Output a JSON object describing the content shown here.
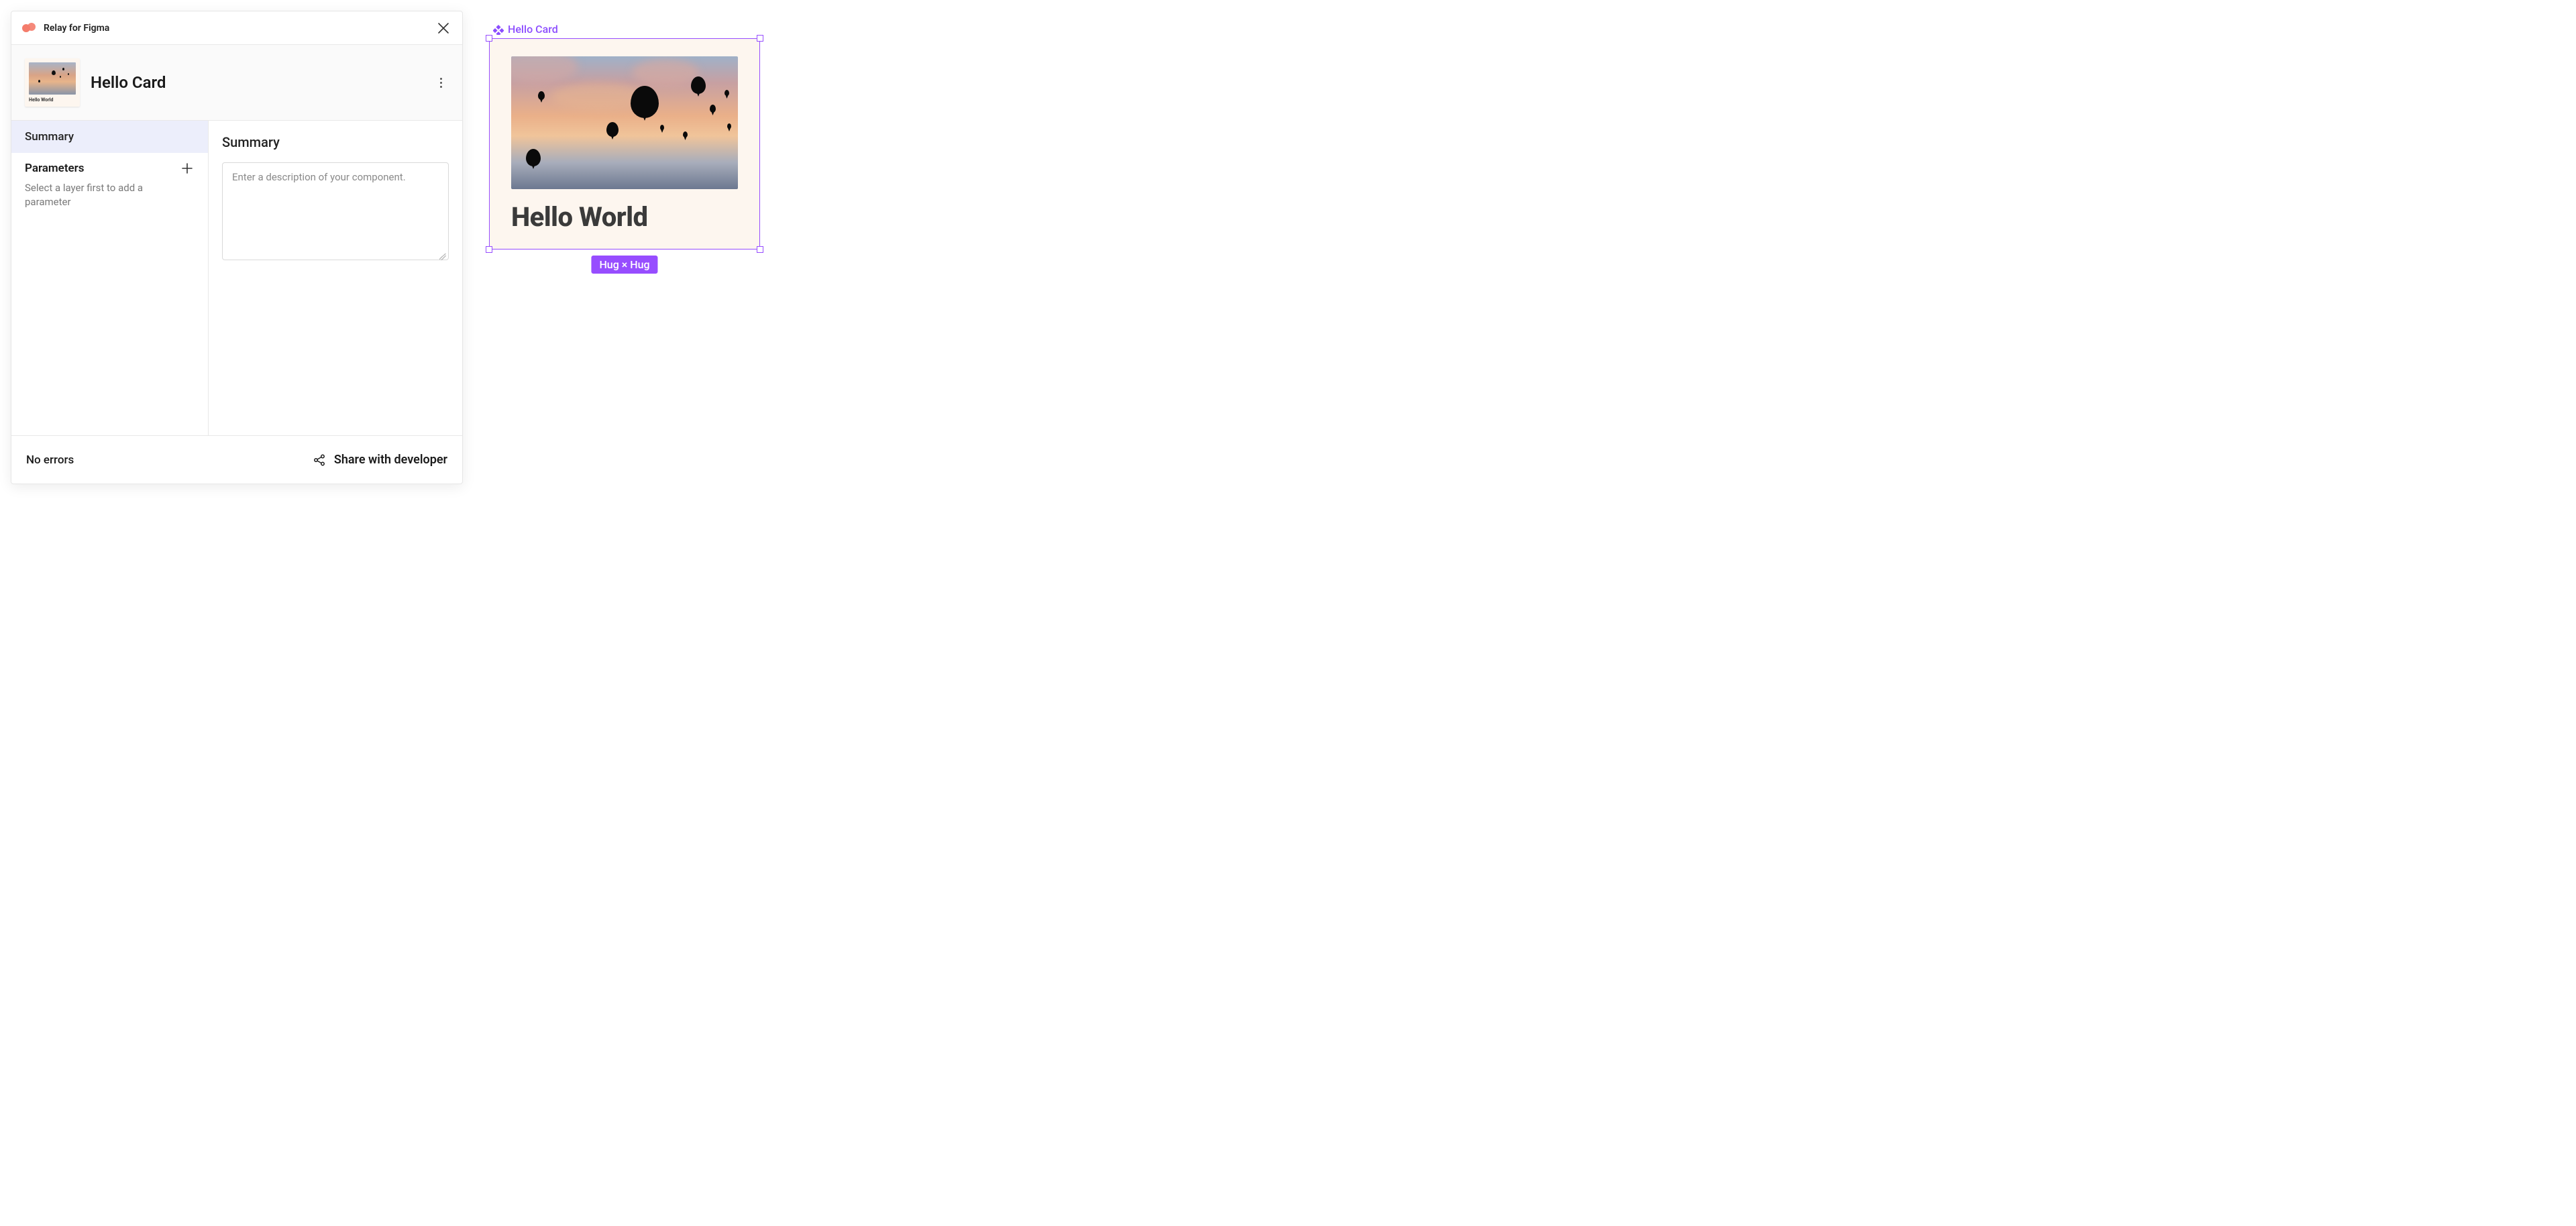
{
  "plugin": {
    "title": "Relay for Figma"
  },
  "component": {
    "name": "Hello Card",
    "thumbnail_text": "Hello World"
  },
  "sidebar": {
    "nav": {
      "summary": "Summary"
    },
    "parameters": {
      "heading": "Parameters",
      "help": "Select a layer first to add a parameter"
    }
  },
  "main": {
    "heading": "Summary",
    "description_placeholder": "Enter a description of your component.",
    "description_value": ""
  },
  "footer": {
    "status": "No errors",
    "share_label": "Share with developer"
  },
  "canvas": {
    "frame_label": "Hello Card",
    "card_text": "Hello World",
    "size_badge": "Hug × Hug"
  }
}
